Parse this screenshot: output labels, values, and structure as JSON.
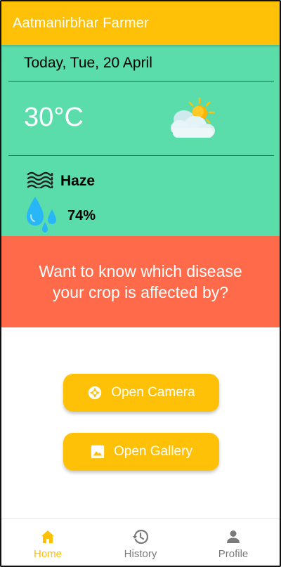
{
  "app": {
    "title": "Aatmanirbhar Farmer"
  },
  "weather": {
    "date": "Today, Tue, 20 April",
    "temperature": "30°C",
    "condition_icon": "partly-cloudy-icon",
    "condition": "Haze",
    "humidity": "74%"
  },
  "banner": {
    "text": "Want to know which disease your crop is affected by?"
  },
  "actions": {
    "camera_label": "Open Camera",
    "gallery_label": "Open Gallery"
  },
  "nav": {
    "items": [
      {
        "label": "Home",
        "icon": "home-icon",
        "active": true
      },
      {
        "label": "History",
        "icon": "history-icon",
        "active": false
      },
      {
        "label": "Profile",
        "icon": "person-icon",
        "active": false
      }
    ]
  },
  "colors": {
    "appbar": "#FFC107",
    "weather_bg": "#5ADDAB",
    "banner_bg": "#FF6B4A",
    "accent": "#FFC107",
    "nav_inactive": "#7a7a7a"
  }
}
